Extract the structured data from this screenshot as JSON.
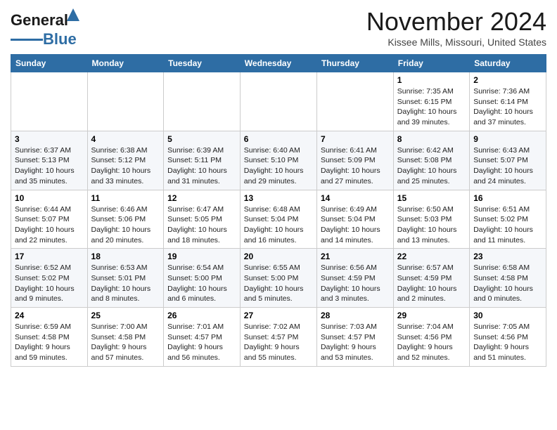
{
  "header": {
    "logo_line1": "General",
    "logo_line2": "Blue",
    "month": "November 2024",
    "location": "Kissee Mills, Missouri, United States"
  },
  "weekdays": [
    "Sunday",
    "Monday",
    "Tuesday",
    "Wednesday",
    "Thursday",
    "Friday",
    "Saturday"
  ],
  "weeks": [
    [
      {
        "day": "",
        "info": ""
      },
      {
        "day": "",
        "info": ""
      },
      {
        "day": "",
        "info": ""
      },
      {
        "day": "",
        "info": ""
      },
      {
        "day": "",
        "info": ""
      },
      {
        "day": "1",
        "info": "Sunrise: 7:35 AM\nSunset: 6:15 PM\nDaylight: 10 hours\nand 39 minutes."
      },
      {
        "day": "2",
        "info": "Sunrise: 7:36 AM\nSunset: 6:14 PM\nDaylight: 10 hours\nand 37 minutes."
      }
    ],
    [
      {
        "day": "3",
        "info": "Sunrise: 6:37 AM\nSunset: 5:13 PM\nDaylight: 10 hours\nand 35 minutes."
      },
      {
        "day": "4",
        "info": "Sunrise: 6:38 AM\nSunset: 5:12 PM\nDaylight: 10 hours\nand 33 minutes."
      },
      {
        "day": "5",
        "info": "Sunrise: 6:39 AM\nSunset: 5:11 PM\nDaylight: 10 hours\nand 31 minutes."
      },
      {
        "day": "6",
        "info": "Sunrise: 6:40 AM\nSunset: 5:10 PM\nDaylight: 10 hours\nand 29 minutes."
      },
      {
        "day": "7",
        "info": "Sunrise: 6:41 AM\nSunset: 5:09 PM\nDaylight: 10 hours\nand 27 minutes."
      },
      {
        "day": "8",
        "info": "Sunrise: 6:42 AM\nSunset: 5:08 PM\nDaylight: 10 hours\nand 25 minutes."
      },
      {
        "day": "9",
        "info": "Sunrise: 6:43 AM\nSunset: 5:07 PM\nDaylight: 10 hours\nand 24 minutes."
      }
    ],
    [
      {
        "day": "10",
        "info": "Sunrise: 6:44 AM\nSunset: 5:07 PM\nDaylight: 10 hours\nand 22 minutes."
      },
      {
        "day": "11",
        "info": "Sunrise: 6:46 AM\nSunset: 5:06 PM\nDaylight: 10 hours\nand 20 minutes."
      },
      {
        "day": "12",
        "info": "Sunrise: 6:47 AM\nSunset: 5:05 PM\nDaylight: 10 hours\nand 18 minutes."
      },
      {
        "day": "13",
        "info": "Sunrise: 6:48 AM\nSunset: 5:04 PM\nDaylight: 10 hours\nand 16 minutes."
      },
      {
        "day": "14",
        "info": "Sunrise: 6:49 AM\nSunset: 5:04 PM\nDaylight: 10 hours\nand 14 minutes."
      },
      {
        "day": "15",
        "info": "Sunrise: 6:50 AM\nSunset: 5:03 PM\nDaylight: 10 hours\nand 13 minutes."
      },
      {
        "day": "16",
        "info": "Sunrise: 6:51 AM\nSunset: 5:02 PM\nDaylight: 10 hours\nand 11 minutes."
      }
    ],
    [
      {
        "day": "17",
        "info": "Sunrise: 6:52 AM\nSunset: 5:02 PM\nDaylight: 10 hours\nand 9 minutes."
      },
      {
        "day": "18",
        "info": "Sunrise: 6:53 AM\nSunset: 5:01 PM\nDaylight: 10 hours\nand 8 minutes."
      },
      {
        "day": "19",
        "info": "Sunrise: 6:54 AM\nSunset: 5:00 PM\nDaylight: 10 hours\nand 6 minutes."
      },
      {
        "day": "20",
        "info": "Sunrise: 6:55 AM\nSunset: 5:00 PM\nDaylight: 10 hours\nand 5 minutes."
      },
      {
        "day": "21",
        "info": "Sunrise: 6:56 AM\nSunset: 4:59 PM\nDaylight: 10 hours\nand 3 minutes."
      },
      {
        "day": "22",
        "info": "Sunrise: 6:57 AM\nSunset: 4:59 PM\nDaylight: 10 hours\nand 2 minutes."
      },
      {
        "day": "23",
        "info": "Sunrise: 6:58 AM\nSunset: 4:58 PM\nDaylight: 10 hours\nand 0 minutes."
      }
    ],
    [
      {
        "day": "24",
        "info": "Sunrise: 6:59 AM\nSunset: 4:58 PM\nDaylight: 9 hours\nand 59 minutes."
      },
      {
        "day": "25",
        "info": "Sunrise: 7:00 AM\nSunset: 4:58 PM\nDaylight: 9 hours\nand 57 minutes."
      },
      {
        "day": "26",
        "info": "Sunrise: 7:01 AM\nSunset: 4:57 PM\nDaylight: 9 hours\nand 56 minutes."
      },
      {
        "day": "27",
        "info": "Sunrise: 7:02 AM\nSunset: 4:57 PM\nDaylight: 9 hours\nand 55 minutes."
      },
      {
        "day": "28",
        "info": "Sunrise: 7:03 AM\nSunset: 4:57 PM\nDaylight: 9 hours\nand 53 minutes."
      },
      {
        "day": "29",
        "info": "Sunrise: 7:04 AM\nSunset: 4:56 PM\nDaylight: 9 hours\nand 52 minutes."
      },
      {
        "day": "30",
        "info": "Sunrise: 7:05 AM\nSunset: 4:56 PM\nDaylight: 9 hours\nand 51 minutes."
      }
    ]
  ]
}
